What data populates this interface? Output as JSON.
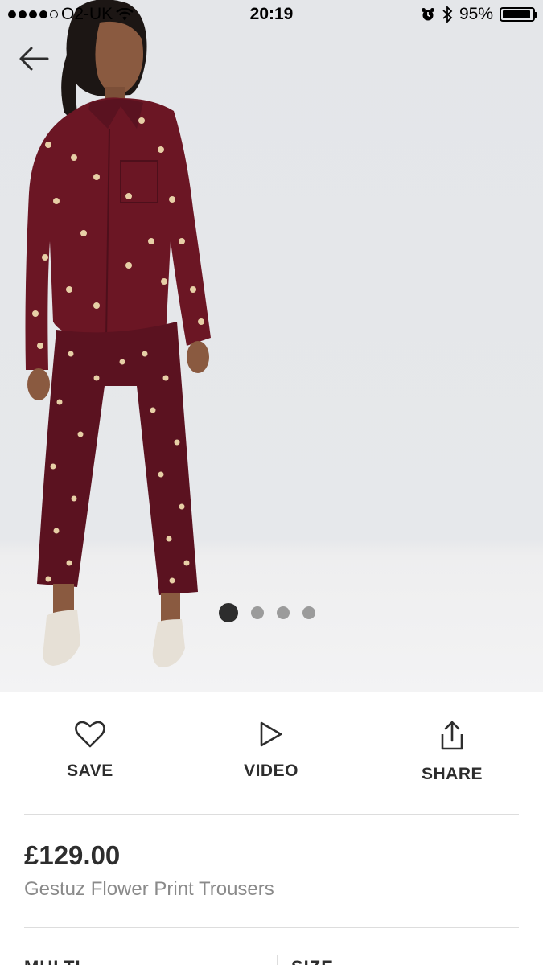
{
  "status_bar": {
    "carrier": "O2-UK",
    "time": "20:19",
    "battery_percent": "95%",
    "battery_level": 0.95,
    "signal_bars_filled": 4,
    "signal_bars_total": 5
  },
  "navigation": {
    "back_icon": "arrow-left-icon"
  },
  "carousel": {
    "image_count": 4,
    "active_index": 0
  },
  "actions": {
    "save_label": "SAVE",
    "save_icon": "heart-icon",
    "video_label": "VIDEO",
    "video_icon": "play-icon",
    "share_label": "SHARE",
    "share_icon": "share-icon"
  },
  "product": {
    "price": "£129.00",
    "name": "Gestuz Flower Print Trousers"
  },
  "selectors": {
    "colour_label": "MULTI",
    "size_label": "SIZE"
  },
  "colors": {
    "text_dark": "#2d2d2d",
    "text_muted": "#8a8a8a",
    "garment_burgundy": "#6b1624",
    "divider": "#dddddd"
  }
}
